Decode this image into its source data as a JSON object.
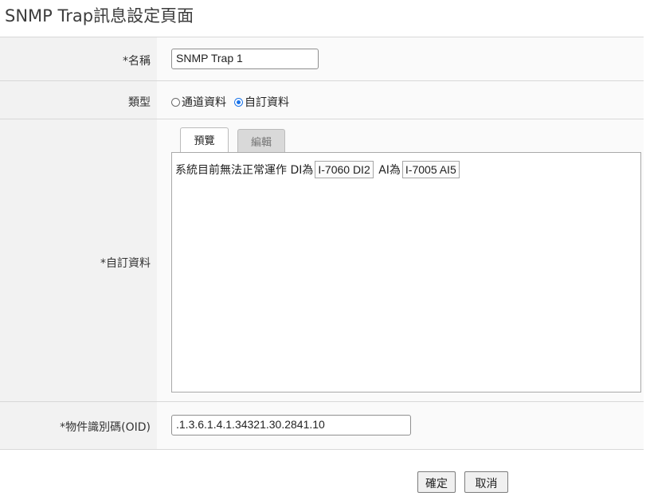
{
  "page_title": "SNMP Trap訊息設定頁面",
  "fields": {
    "name_label": "*名稱",
    "name_value": "SNMP Trap 1",
    "type_label": "類型",
    "type_options": [
      "通道資料",
      "自訂資料"
    ],
    "type_selected": "自訂資料",
    "custom_label": "*自訂資料",
    "oid_label": "*物件識別碼(OID)",
    "oid_value": ".1.3.6.1.4.1.34321.30.2841.10"
  },
  "editor": {
    "tabs": [
      "預覽",
      "編輯"
    ],
    "active_tab": "預覽",
    "text_prefix": "系統目前無法正常運作 DI為",
    "chip_di": "I-7060 DI2",
    "text_mid": "AI為",
    "chip_ai": "I-7005 AI5"
  },
  "buttons": {
    "confirm": "確定",
    "cancel": "取消"
  },
  "colors": {
    "label_bg": "#f2f2f2",
    "value_bg": "#fafafa",
    "radio_accent": "#1a73e8"
  }
}
